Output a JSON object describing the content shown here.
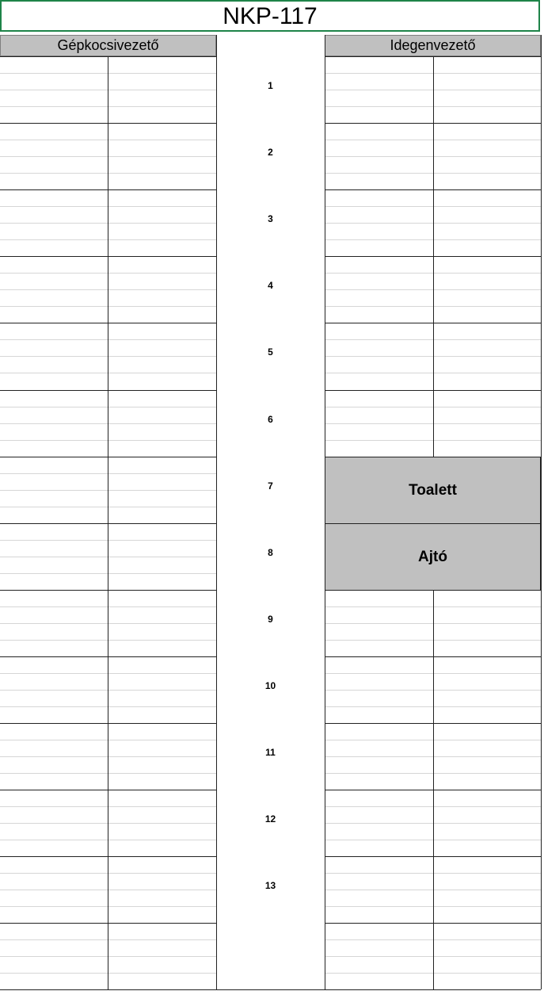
{
  "sheet": {
    "title": "NKP-117",
    "driver_header": "Gépkocsivezető",
    "guide_header": "Idegenvezető",
    "seat_numbers": [
      "1",
      "2",
      "3",
      "4",
      "5",
      "6",
      "7",
      "8",
      "9",
      "10",
      "11",
      "12",
      "13"
    ],
    "toilet_label": "Toalett",
    "door_label": "Ajtó"
  },
  "colors": {
    "header_bg": "#c0c0c0",
    "selection_border": "#1e8449",
    "grid_light": "#d6d6d6",
    "grid_dark": "#222222"
  }
}
